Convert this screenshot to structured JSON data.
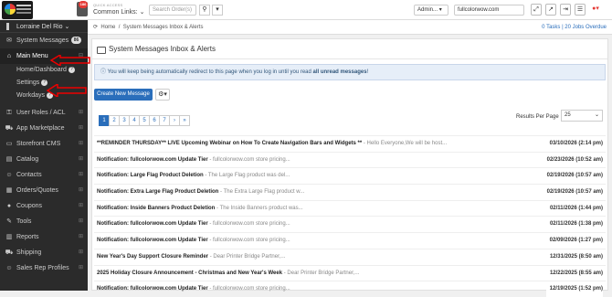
{
  "header": {
    "notifications_count": "186",
    "quick_access_label": "QUICK ACCESS",
    "quick_access_value": "Common Links:",
    "search_placeholder": "Search Order(s)",
    "admin_label": "Admin...",
    "site_value": "fullcolorwow.com"
  },
  "sidebar": {
    "user_name": "Lorraine Del Rio",
    "items": [
      {
        "label": "System Messages",
        "icon": "envelope-icon",
        "badge": "86"
      },
      {
        "label": "Main Menu",
        "icon": "home-icon"
      },
      {
        "label": "User Roles / ACL",
        "icon": "key-icon"
      },
      {
        "label": "App Marketplace",
        "icon": "cart-icon"
      },
      {
        "label": "Storefront CMS",
        "icon": "monitor-icon"
      },
      {
        "label": "Catalog",
        "icon": "catalog-icon"
      },
      {
        "label": "Contacts",
        "icon": "contacts-icon"
      },
      {
        "label": "Orders/Quotes",
        "icon": "orders-icon"
      },
      {
        "label": "Coupons",
        "icon": "coupon-icon"
      },
      {
        "label": "Tools",
        "icon": "wrench-icon"
      },
      {
        "label": "Reports",
        "icon": "chart-icon"
      },
      {
        "label": "Shipping",
        "icon": "truck-icon"
      },
      {
        "label": "Sales Rep Profiles",
        "icon": "rep-icon"
      }
    ],
    "sub_items": [
      {
        "label": "Home/Dashboard"
      },
      {
        "label": "Settings"
      },
      {
        "label": "Workdays"
      }
    ]
  },
  "breadcrumb": {
    "home": "Home",
    "current": "System Messages Inbox & Alerts",
    "right_text": "0 Tasks  |  20 Jobs Overdue"
  },
  "panel": {
    "title": "System Messages Inbox & Alerts",
    "alert_text": "You will keep being automatically redirect to this page when you log in until you read ",
    "alert_bold": "all unread messages",
    "alert_end": "!",
    "new_button": "Create New Message",
    "pages": [
      "1",
      "2",
      "3",
      "4",
      "5",
      "6",
      "7",
      "›",
      "»"
    ],
    "results_label": "Results Per Page",
    "results_value": "25"
  },
  "messages": [
    {
      "subject": "**REMINDER THURSDAY** LIVE Upcoming Webinar on How To Create Navigation Bars and Widgets **",
      "preview": " - Hello Everyone,We will be host...",
      "date": "03/10/2026 (2:14 pm)"
    },
    {
      "subject": "Notification: fullcolorwow.com Update Tier",
      "preview": " - fullcolorwow.com store pricing...",
      "date": "02/23/2026 (10:52 am)"
    },
    {
      "subject": "Notification: Large Flag Product Deletion",
      "preview": " - The Large Flag product was del...",
      "date": "02/19/2026 (10:57 am)"
    },
    {
      "subject": "Notification: Extra Large Flag Product Deletion",
      "preview": " - The Extra Large Flag product w...",
      "date": "02/19/2026 (10:57 am)"
    },
    {
      "subject": "Notification: Inside Banners Product Deletion",
      "preview": " - The Inside Banners product was...",
      "date": "02/11/2026 (1:44 pm)"
    },
    {
      "subject": "Notification: fullcolorwow.com Update Tier",
      "preview": " - fullcolorwow.com store pricing...",
      "date": "02/11/2026 (1:38 pm)"
    },
    {
      "subject": "Notification: fullcolorwow.com Update Tier",
      "preview": " - fullcolorwow.com store pricing...",
      "date": "02/09/2026 (1:27 pm)"
    },
    {
      "subject": "New Year's Day Support Closure Reminder",
      "preview": " - Dear Printer Bridge Partner,...",
      "date": "12/31/2025 (8:50 am)"
    },
    {
      "subject": "2025 Holiday Closure Announcement - Christmas and New Year's Week",
      "preview": " - Dear Printer Bridge Partner,...",
      "date": "12/22/2025 (8:55 am)"
    },
    {
      "subject": "Notification: fullcolorwow.com Update Tier",
      "preview": " - fullcolorwow.com store pricing...",
      "date": "12/19/2025 (1:52 pm)"
    }
  ]
}
